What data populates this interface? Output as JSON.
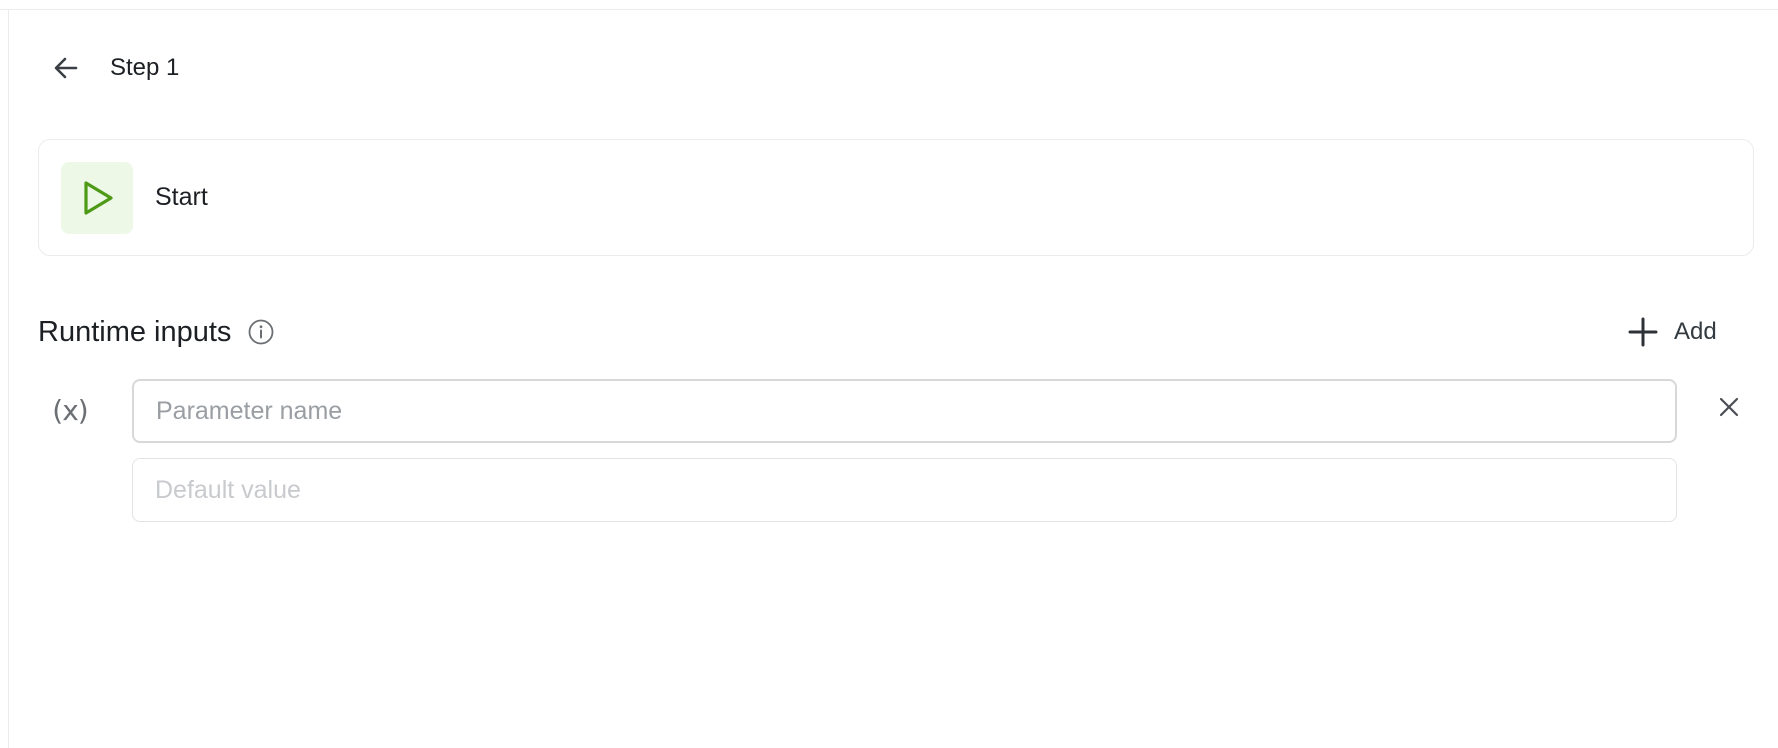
{
  "header": {
    "title": "Step 1",
    "back_icon": "arrow-left-icon"
  },
  "start_card": {
    "label": "Start",
    "icon": "play-icon",
    "icon_color": "#4c9a15",
    "icon_bg": "#eef8e7"
  },
  "runtime_inputs": {
    "title": "Runtime inputs",
    "info_icon": "info-icon",
    "add_label": "Add",
    "add_icon": "plus-icon",
    "variable_icon_text": "(x)",
    "parameter": {
      "value": "",
      "placeholder": "Parameter name"
    },
    "default": {
      "value": "",
      "placeholder": "Default value"
    },
    "remove_icon": "close-icon"
  }
}
